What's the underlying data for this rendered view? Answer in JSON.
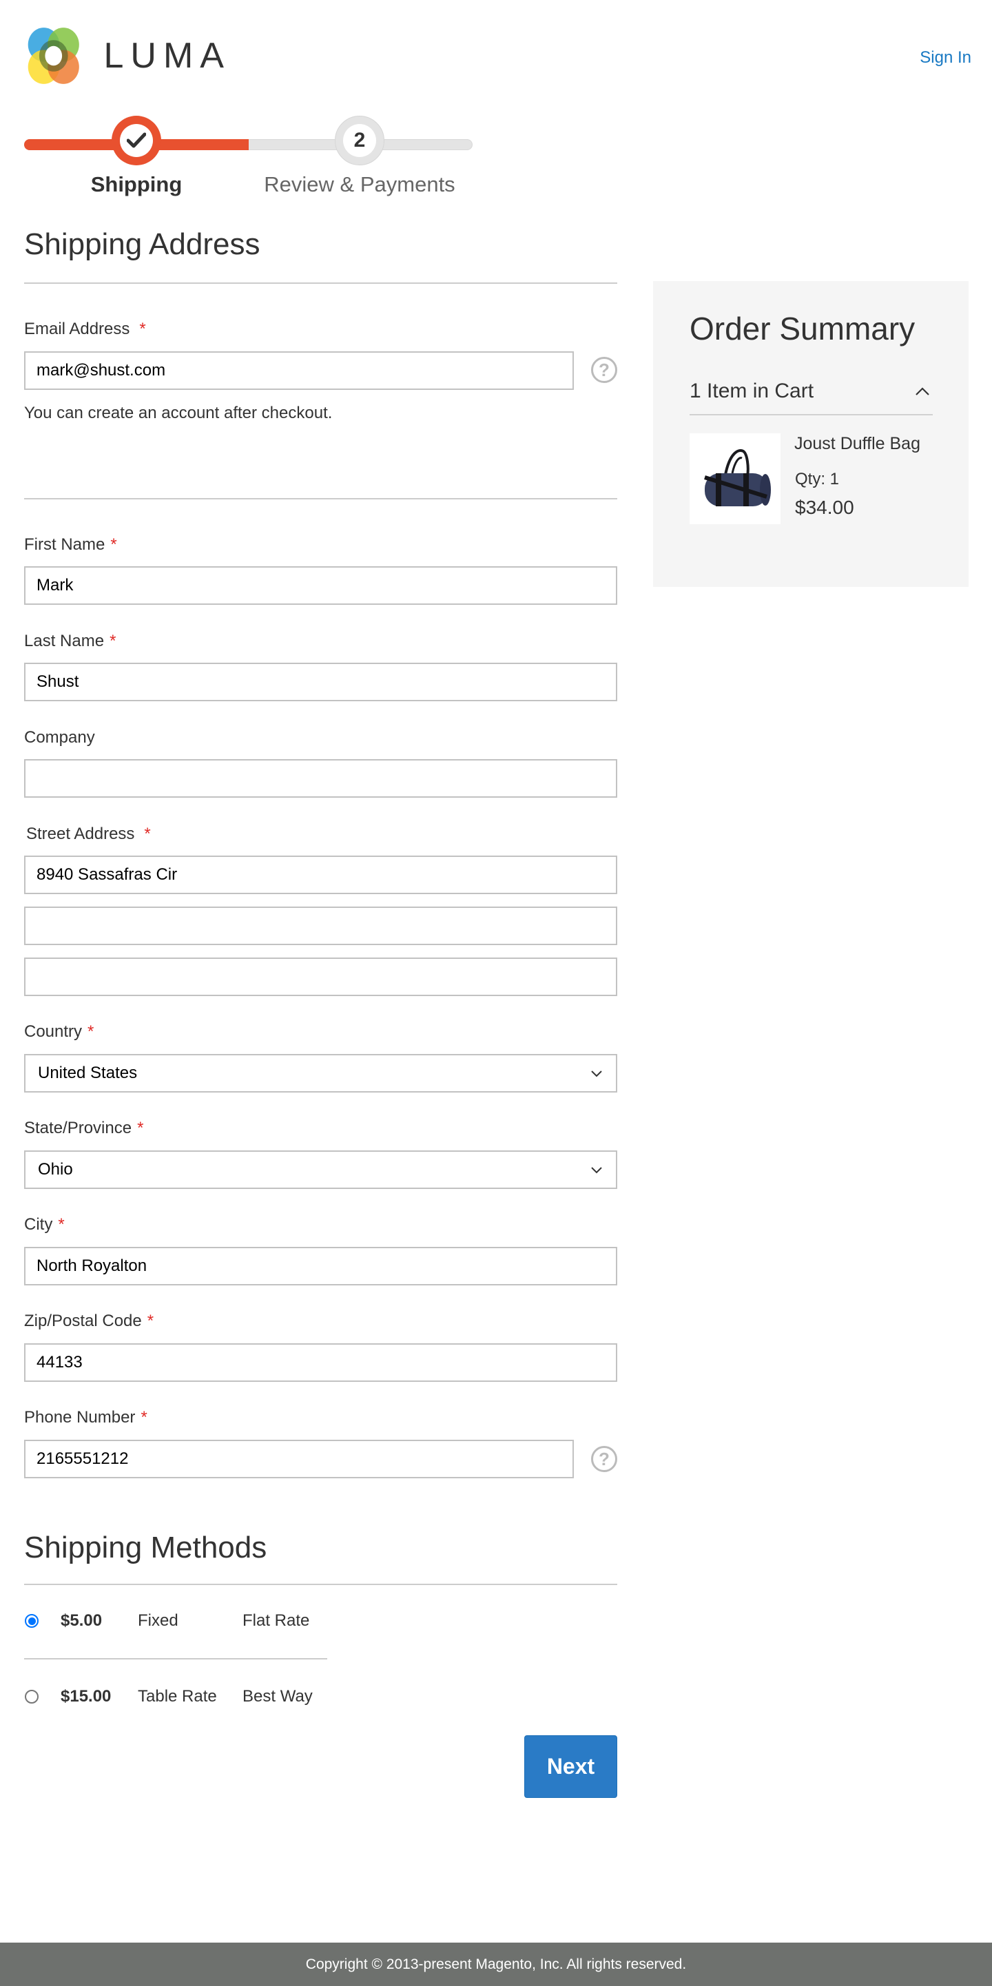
{
  "header": {
    "brand": "LUMA",
    "sign_in": "Sign In"
  },
  "progress": {
    "steps": [
      {
        "number": "1",
        "label": "Shipping",
        "state": "complete"
      },
      {
        "number": "2",
        "label": "Review & Payments",
        "state": "pending"
      }
    ],
    "completed_fraction": 0.5
  },
  "shipping_address": {
    "title": "Shipping Address",
    "required_mark": "*",
    "email": {
      "label": "Email Address",
      "value": "mark@shust.com",
      "note": "You can create an account after checkout."
    },
    "first_name": {
      "label": "First Name",
      "value": "Mark"
    },
    "last_name": {
      "label": "Last Name",
      "value": "Shust"
    },
    "company": {
      "label": "Company",
      "value": ""
    },
    "street": {
      "label": "Street Address",
      "lines": [
        "8940 Sassafras Cir",
        "",
        ""
      ]
    },
    "country": {
      "label": "Country",
      "value": "United States"
    },
    "state": {
      "label": "State/Province",
      "value": "Ohio"
    },
    "city": {
      "label": "City",
      "value": "North Royalton"
    },
    "zip": {
      "label": "Zip/Postal Code",
      "value": "44133"
    },
    "phone": {
      "label": "Phone Number",
      "value": "2165551212"
    },
    "help_glyph": "?"
  },
  "shipping_methods": {
    "title": "Shipping Methods",
    "options": [
      {
        "price": "$5.00",
        "method": "Fixed",
        "carrier": "Flat Rate",
        "selected": true
      },
      {
        "price": "$15.00",
        "method": "Table Rate",
        "carrier": "Best Way",
        "selected": false
      }
    ],
    "next_label": "Next"
  },
  "order_summary": {
    "title": "Order Summary",
    "cart_count_label": "1 Item in Cart",
    "items": [
      {
        "name": "Joust Duffle Bag",
        "qty_label": "Qty: 1",
        "price": "$34.00"
      }
    ]
  },
  "footer": {
    "copyright": "Copyright © 2013-present Magento, Inc. All rights reserved."
  },
  "colors": {
    "accent_orange": "#e8512f",
    "link_blue": "#1979c3",
    "button_blue": "#2a7bc6",
    "required_red": "#e02b27",
    "footer_gray": "#6e716e",
    "summary_bg": "#f5f5f5"
  }
}
